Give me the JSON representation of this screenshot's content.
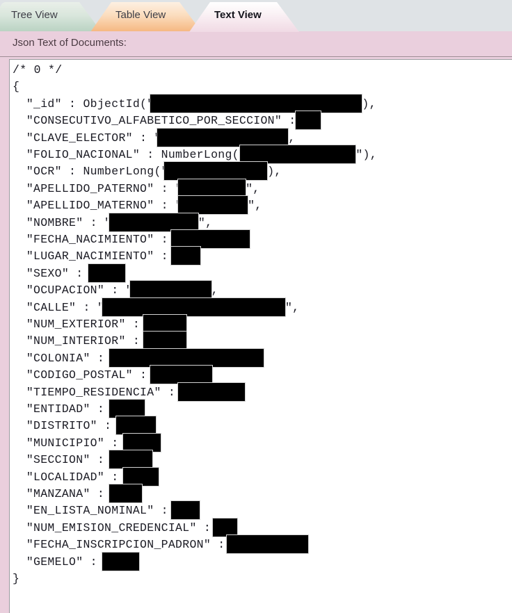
{
  "window": {
    "background_color": "#dfe3e6",
    "accent_pink": "#eacfdd"
  },
  "tabs": [
    {
      "label": "Tree View",
      "active": false,
      "color": "#b9d2c2"
    },
    {
      "label": "Table View",
      "active": false,
      "color": "#f5b780"
    },
    {
      "label": "Text View",
      "active": true,
      "color": "#f0d9e4"
    }
  ],
  "panel": {
    "header_label": "Json Text of Documents:"
  },
  "document": {
    "comment": "/* 0 */",
    "open_brace": "{",
    "close_brace": "}",
    "fields": [
      {
        "key": "_id",
        "prefix": "\"_id\" : ObjectId(\"",
        "suffix": "),",
        "redaction_width": 304
      },
      {
        "key": "CONSECUTIVO_ALFABETICO_POR_SECCION",
        "prefix": "\"CONSECUTIVO_ALFABETICO_POR_SECCION\" : ",
        "suffix": "",
        "redaction_width": 36
      },
      {
        "key": "CLAVE_ELECTOR",
        "prefix": "\"CLAVE_ELECTOR\" : \"",
        "suffix": ",",
        "redaction_width": 188
      },
      {
        "key": "FOLIO_NACIONAL",
        "prefix": "\"FOLIO_NACIONAL\" : NumberLong(\"",
        "suffix": "\"),",
        "redaction_width": 166
      },
      {
        "key": "OCR",
        "prefix": "\"OCR\" : NumberLong(\"",
        "suffix": "),",
        "redaction_width": 148
      },
      {
        "key": "APELLIDO_PATERNO",
        "prefix": "\"APELLIDO_PATERNO\" : \"",
        "suffix": "\",",
        "redaction_width": 97
      },
      {
        "key": "APELLIDO_MATERNO",
        "prefix": "\"APELLIDO_MATERNO\" : \"",
        "suffix": "\",",
        "redaction_width": 100
      },
      {
        "key": "NOMBRE",
        "prefix": "\"NOMBRE\" : \"",
        "suffix": "\",",
        "redaction_width": 128
      },
      {
        "key": "FECHA_NACIMIENTO",
        "prefix": "\"FECHA_NACIMIENTO\" : ",
        "suffix": "",
        "redaction_width": 113
      },
      {
        "key": "LUGAR_NACIMIENTO",
        "prefix": "\"LUGAR_NACIMIENTO\" : ",
        "suffix": "",
        "redaction_width": 42
      },
      {
        "key": "SEXO",
        "prefix": "\"SEXO\" : ",
        "suffix": "",
        "redaction_width": 53
      },
      {
        "key": "OCUPACION",
        "prefix": "\"OCUPACION\" : \"",
        "suffix": ",",
        "redaction_width": 117
      },
      {
        "key": "CALLE",
        "prefix": "\"CALLE\" : \"",
        "suffix": "\",",
        "redaction_width": 263
      },
      {
        "key": "NUM_EXTERIOR",
        "prefix": "\"NUM_EXTERIOR\" : ",
        "suffix": "",
        "redaction_width": 62
      },
      {
        "key": "NUM_INTERIOR",
        "prefix": "\"NUM_INTERIOR\" : ",
        "suffix": "",
        "redaction_width": 62
      },
      {
        "key": "COLONIA",
        "prefix": "\"COLONIA\" : ",
        "suffix": "",
        "redaction_width": 222
      },
      {
        "key": "CODIGO_POSTAL",
        "prefix": "\"CODIGO_POSTAL\" : ",
        "suffix": "",
        "redaction_width": 89
      },
      {
        "key": "TIEMPO_RESIDENCIA",
        "prefix": "\"TIEMPO_RESIDENCIA\" : ",
        "suffix": "",
        "redaction_width": 96
      },
      {
        "key": "ENTIDAD",
        "prefix": "\"ENTIDAD\" : ",
        "suffix": "",
        "redaction_width": 51
      },
      {
        "key": "DISTRITO",
        "prefix": "\"DISTRITO\" : ",
        "suffix": "",
        "redaction_width": 57
      },
      {
        "key": "MUNICIPIO",
        "prefix": "\"MUNICIPIO\" : ",
        "suffix": "",
        "redaction_width": 54
      },
      {
        "key": "SECCION",
        "prefix": "\"SECCION\" : ",
        "suffix": "",
        "redaction_width": 62
      },
      {
        "key": "LOCALIDAD",
        "prefix": "\"LOCALIDAD\" : ",
        "suffix": "",
        "redaction_width": 51
      },
      {
        "key": "MANZANA",
        "prefix": "\"MANZANA\" : ",
        "suffix": "",
        "redaction_width": 47
      },
      {
        "key": "EN_LISTA_NOMINAL",
        "prefix": "\"EN_LISTA_NOMINAL\" : ",
        "suffix": "",
        "redaction_width": 41
      },
      {
        "key": "NUM_EMISION_CREDENCIAL",
        "prefix": "\"NUM_EMISION_CREDENCIAL\" : ",
        "suffix": "",
        "redaction_width": 35
      },
      {
        "key": "FECHA_INSCRIPCION_PADRON",
        "prefix": "\"FECHA_INSCRIPCION_PADRON\" : ",
        "suffix": "",
        "redaction_width": 117
      },
      {
        "key": "GEMELO",
        "prefix": "\"GEMELO\" : ",
        "suffix": "",
        "redaction_width": 53
      }
    ]
  }
}
